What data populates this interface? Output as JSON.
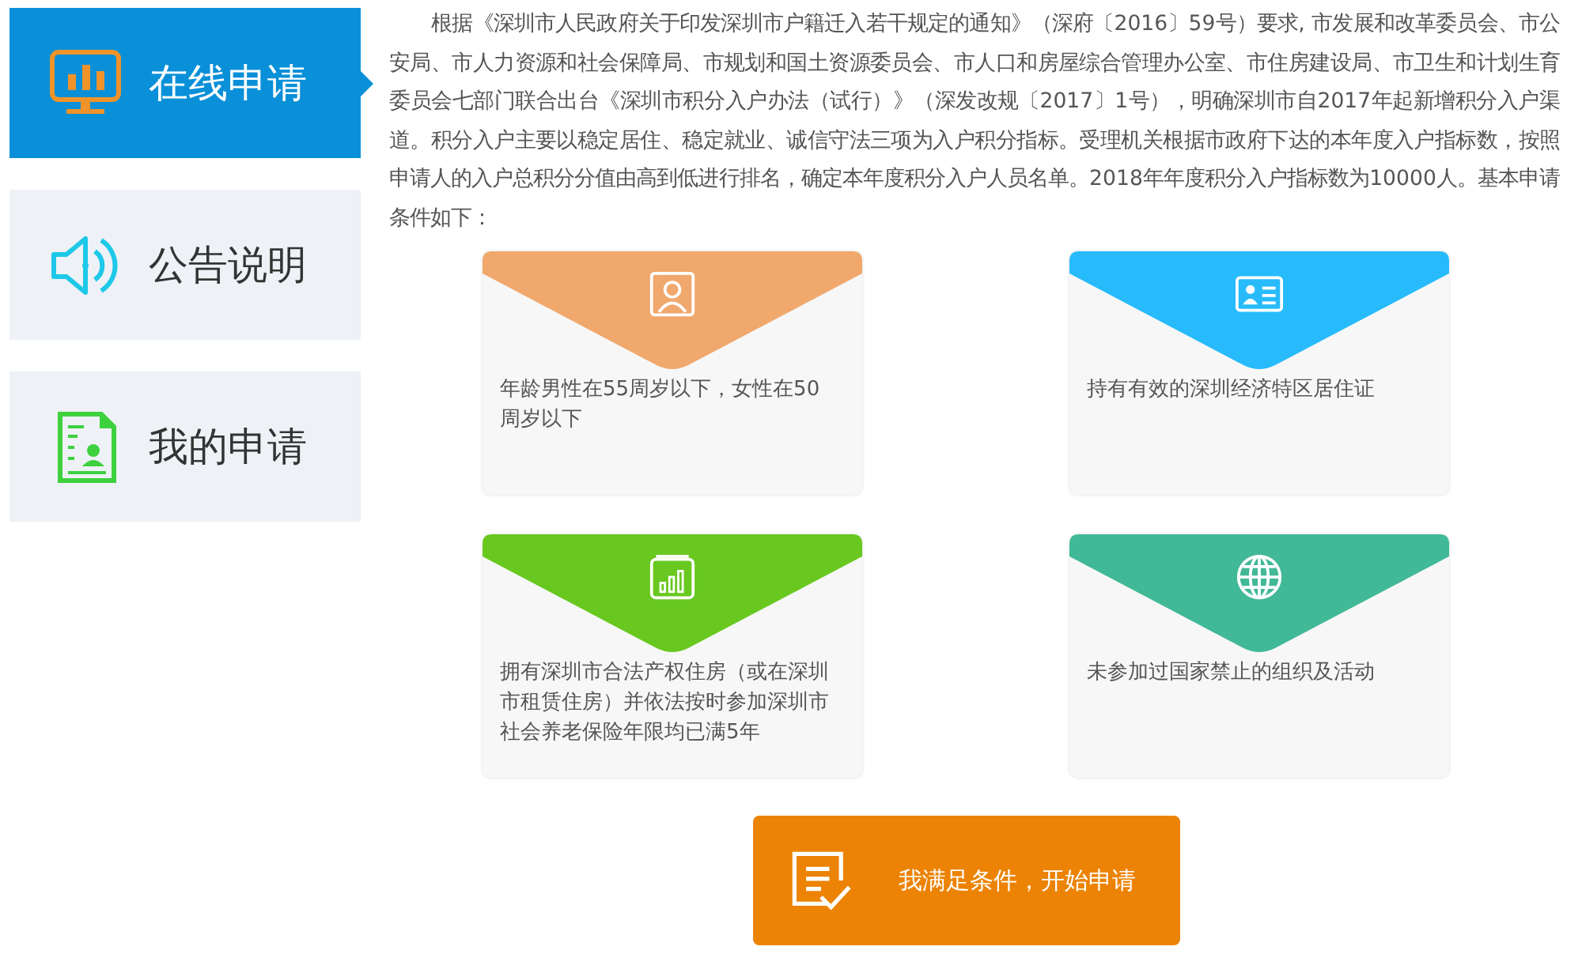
{
  "sidebar": {
    "items": [
      {
        "label": "在线申请",
        "kind": "monitor",
        "selected": true
      },
      {
        "label": "公告说明",
        "kind": "speaker",
        "selected": false
      },
      {
        "label": "我的申请",
        "kind": "document",
        "selected": false
      }
    ]
  },
  "intro": "根据《深圳市人民政府关于印发深圳市户籍迁入若干规定的通知》（深府〔2016〕59号）要求, 市发展和改革委员会、市公安局、市人力资源和社会保障局、市规划和国土资源委员会、市人口和房屋综合管理办公室、市住房建设局、市卫生和计划生育委员会七部门联合出台《深圳市积分入户办法（试行）》（深发改规〔2017〕1号），明确深圳市自2017年起新增积分入户渠道。积分入户主要以稳定居住、稳定就业、诚信守法三项为入户积分指标。受理机关根据市政府下达的本年度入户指标数，按照申请人的入户总积分分值由高到低进行排名，确定本年度积分入户人员名单。2018年年度积分入户指标数为10000人。基本申请条件如下：",
  "conditions": [
    {
      "text": "年龄男性在55周岁以下，女性在50周岁以下",
      "kind": "person",
      "color": "#f0a86c"
    },
    {
      "text": "持有有效的深圳经济特区居住证",
      "kind": "idcard",
      "color": "#27bbfb"
    },
    {
      "text": "拥有深圳市合法产权住房（或在深圳市租赁住房）并依法按时参加深圳市社会养老保险年限均已满5年",
      "kind": "chart",
      "color": "#68c81f"
    },
    {
      "text": "未参加过国家禁止的组织及活动",
      "kind": "globe",
      "color": "#41b997"
    }
  ],
  "start_button": {
    "label": "我满足条件，开始申请"
  }
}
